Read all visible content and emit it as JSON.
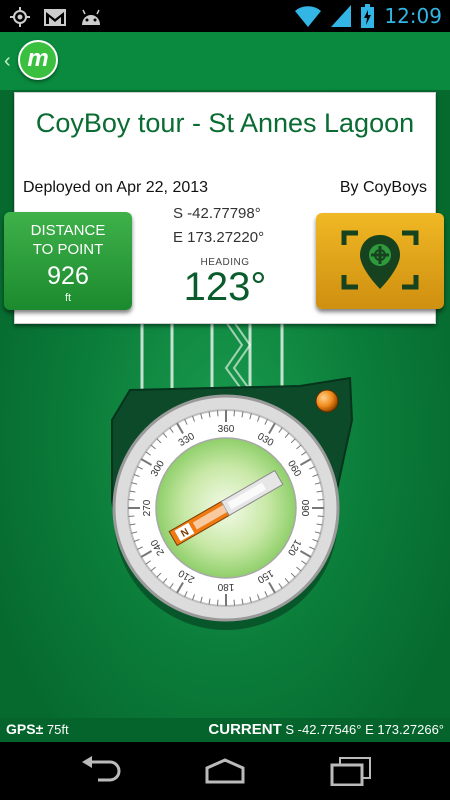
{
  "status_bar": {
    "time": "12:09",
    "icons": [
      "gps-icon",
      "gmail-icon",
      "android-icon",
      "wifi-icon",
      "signal-icon",
      "battery-icon"
    ]
  },
  "app_bar": {
    "logo_letter": "m"
  },
  "tour": {
    "title": "CoyBoy tour - St Annes Lagoon",
    "deployed": "Deployed on Apr 22, 2013",
    "author": "By CoyBoys",
    "latitude": "S -42.77798°",
    "longitude": "E 173.27220°",
    "heading_label": "HEADING",
    "heading_value": "123°"
  },
  "distance": {
    "label_line1": "DISTANCE",
    "label_line2": "TO POINT",
    "value": "926",
    "unit": "ft"
  },
  "compass": {
    "labels": [
      "360",
      "030",
      "060",
      "090",
      "120",
      "150",
      "180",
      "210",
      "240",
      "270",
      "300",
      "330"
    ],
    "needle_letter": "N",
    "needle_heading_deg": 123
  },
  "footer": {
    "gps_label": "GPS±",
    "gps_accuracy": "75ft",
    "current_label": "CURRENT",
    "current_latitude": "S -42.77546°",
    "current_longitude": "E 173.27266°"
  },
  "colors": {
    "brand_green": "#0a8a3e",
    "title_green": "#0a6b33",
    "accent_orange": "#f0a11a",
    "status_blue": "#33b5e5"
  }
}
